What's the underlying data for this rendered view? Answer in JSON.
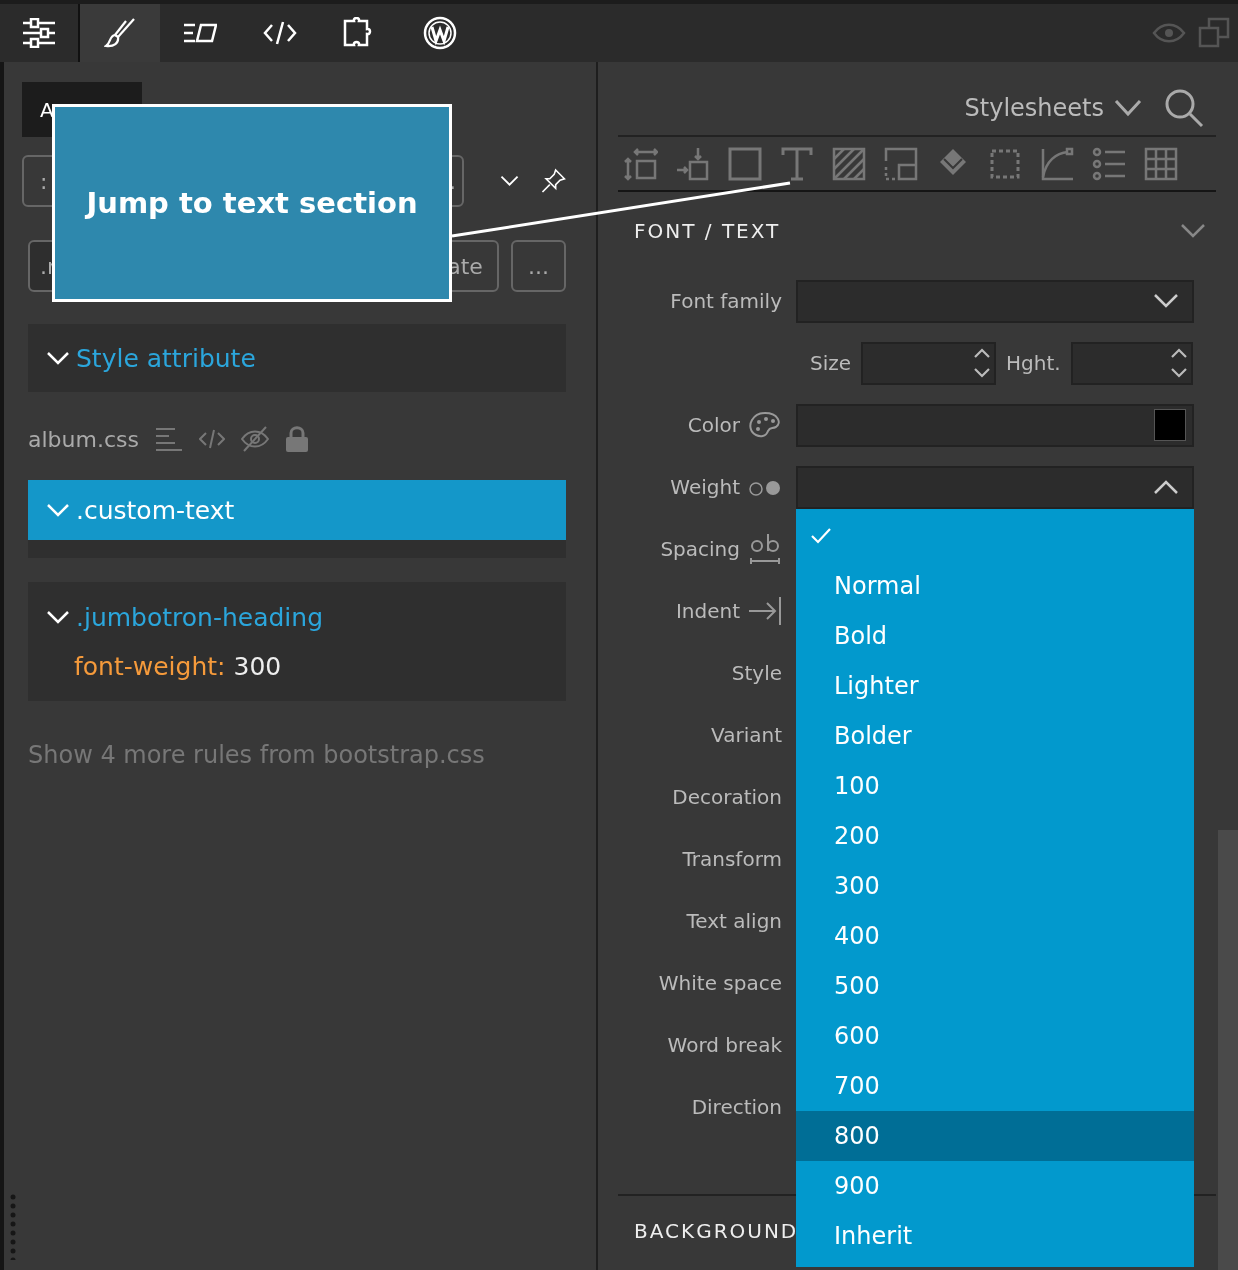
{
  "toolbar": {
    "tabs": [
      {
        "selected": false
      },
      {
        "selected": true
      },
      {
        "selected": false
      },
      {
        "selected": false
      },
      {
        "selected": false
      },
      {
        "selected": false
      }
    ]
  },
  "left_panel": {
    "mode_tab": "A",
    "filter_buttons": [
      ":",
      "."
    ],
    "action_buttons": [
      ".r",
      "ate",
      "..."
    ],
    "style_attribute": {
      "title": "Style attribute",
      "expanded": true
    },
    "stylesheet": {
      "name": "album.css",
      "rules": [
        {
          "selector": ".custom-text",
          "selected": true,
          "expanded": true
        },
        {
          "selector": ".jumbotron-heading",
          "selected": false,
          "expanded": true,
          "declarations": [
            {
              "property": "font-weight:",
              "value": "300"
            }
          ]
        }
      ]
    },
    "more_rules": "Show 4 more rules from bootstrap.css"
  },
  "callout": {
    "text": "Jump to text section"
  },
  "right_panel": {
    "source_menu": "Stylesheets",
    "section": {
      "title": "FONT / TEXT",
      "expanded": true,
      "rows": [
        {
          "kind": "select",
          "label": "Font family",
          "expanded": false
        },
        {
          "kind": "spin-pair",
          "labels": [
            "Size",
            "Hght."
          ]
        },
        {
          "kind": "color",
          "label": "Color"
        },
        {
          "kind": "select",
          "label": "Weight",
          "expanded": true
        },
        {
          "kind": "label",
          "label": "Spacing"
        },
        {
          "kind": "label",
          "label": "Indent"
        },
        {
          "kind": "label",
          "label": "Style"
        },
        {
          "kind": "label",
          "label": "Variant"
        },
        {
          "kind": "label",
          "label": "Decoration"
        },
        {
          "kind": "label",
          "label": "Transform"
        },
        {
          "kind": "label",
          "label": "Text align"
        },
        {
          "kind": "label",
          "label": "White space"
        },
        {
          "kind": "label",
          "label": "Word break"
        },
        {
          "kind": "label",
          "label": "Direction"
        }
      ]
    },
    "weight_options": [
      {
        "selected": true,
        "hovered": false
      },
      {
        "label": "Normal",
        "selected": false,
        "hovered": false
      },
      {
        "label": "Bold",
        "selected": false,
        "hovered": false
      },
      {
        "label": "Lighter",
        "selected": false,
        "hovered": false
      },
      {
        "label": "Bolder",
        "selected": false,
        "hovered": false
      },
      {
        "label": "100",
        "selected": false,
        "hovered": false
      },
      {
        "label": "200",
        "selected": false,
        "hovered": false
      },
      {
        "label": "300",
        "selected": false,
        "hovered": false
      },
      {
        "label": "400",
        "selected": false,
        "hovered": false
      },
      {
        "label": "500",
        "selected": false,
        "hovered": false
      },
      {
        "label": "600",
        "selected": false,
        "hovered": false
      },
      {
        "label": "700",
        "selected": false,
        "hovered": false
      },
      {
        "label": "800",
        "selected": false,
        "hovered": true
      },
      {
        "label": "900",
        "selected": false,
        "hovered": false
      },
      {
        "label": "Inherit",
        "selected": false,
        "hovered": false
      }
    ],
    "next_section": {
      "title": "BACKGROUND"
    }
  }
}
